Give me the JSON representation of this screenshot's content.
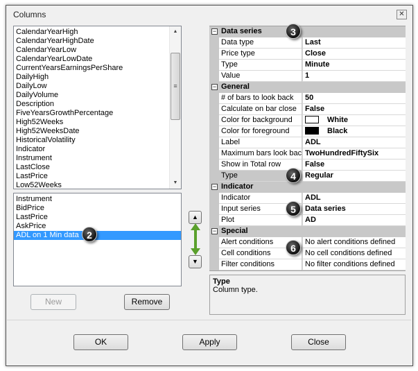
{
  "window": {
    "title": "Columns",
    "close_icon": "close-icon"
  },
  "available_columns": [
    "CalendarYearHigh",
    "CalendarYearHighDate",
    "CalendarYearLow",
    "CalendarYearLowDate",
    "CurrentYearsEarningsPerShare",
    "DailyHigh",
    "DailyLow",
    "DailyVolume",
    "Description",
    "FiveYearsGrowthPercentage",
    "High52Weeks",
    "High52WeeksDate",
    "HistoricalVolatility",
    "Indicator",
    "Instrument",
    "LastClose",
    "LastPrice",
    "Low52Weeks"
  ],
  "selected_columns": {
    "items": [
      "Instrument",
      "BidPrice",
      "LastPrice",
      "AskPrice",
      "ADL on 1 Min data"
    ],
    "selected": "ADL on 1 Min data"
  },
  "buttons": {
    "new": "New",
    "remove": "Remove",
    "ok": "OK",
    "apply": "Apply",
    "close": "Close",
    "move_up": "▲",
    "move_down": "▼"
  },
  "properties": {
    "data_series": {
      "title": "Data series",
      "rows": [
        [
          "Data type",
          "Last"
        ],
        [
          "Price type",
          "Close"
        ],
        [
          "Type",
          "Minute"
        ],
        [
          "Value",
          "1"
        ]
      ]
    },
    "general": {
      "title": "General",
      "rows": [
        [
          "# of bars to look back",
          "50"
        ],
        [
          "Calculate on bar close",
          "False"
        ],
        [
          "Color for background",
          "White"
        ],
        [
          "Color for foreground",
          "Black"
        ],
        [
          "Label",
          "ADL"
        ],
        [
          "Maximum bars look back",
          "TwoHundredFiftySix"
        ],
        [
          "Show in Total row",
          "False"
        ],
        [
          "Type",
          "Regular"
        ]
      ]
    },
    "indicator": {
      "title": "Indicator",
      "rows": [
        [
          "Indicator",
          "ADL"
        ],
        [
          "Input series",
          "Data series"
        ],
        [
          "Plot",
          "AD"
        ]
      ]
    },
    "special": {
      "title": "Special",
      "rows": [
        [
          "Alert conditions",
          "No alert conditions defined"
        ],
        [
          "Cell conditions",
          "No cell conditions defined"
        ],
        [
          "Filter conditions",
          "No filter conditions defined"
        ]
      ]
    }
  },
  "colors": {
    "background": "#ffffff",
    "foreground": "#000000",
    "selection": "#3399ff",
    "arrow": "#5aa02c"
  },
  "description": {
    "title": "Type",
    "text": "Column type."
  },
  "badges": [
    "2",
    "3",
    "4",
    "5",
    "6"
  ]
}
